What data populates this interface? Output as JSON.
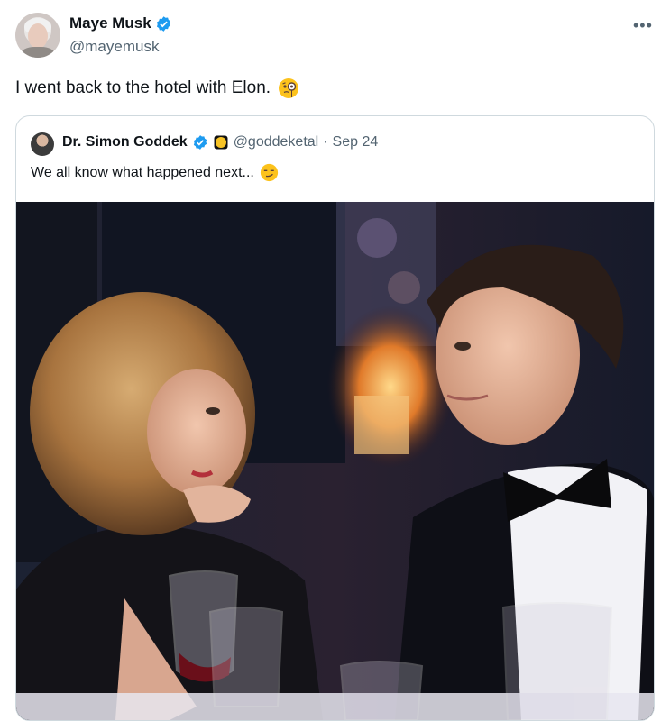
{
  "author": {
    "name": "Maye Musk",
    "handle": "@mayemusk",
    "verified_color": "#1d9bf0"
  },
  "more_icon": "ellipsis-icon",
  "tweet": {
    "text": "I went back to the hotel with Elon.",
    "emoji": "monocle-face-emoji"
  },
  "quoted_tweet": {
    "name": "Dr. Simon Goddek",
    "handle": "@goddeketal",
    "separator": "·",
    "date": "Sep 24",
    "text": "We all know what happened next...",
    "emoji": "smirking-face-emoji",
    "badge": "yellow-circle-emoji"
  },
  "colors": {
    "secondary_text": "#536471",
    "border": "#cfd9de"
  }
}
